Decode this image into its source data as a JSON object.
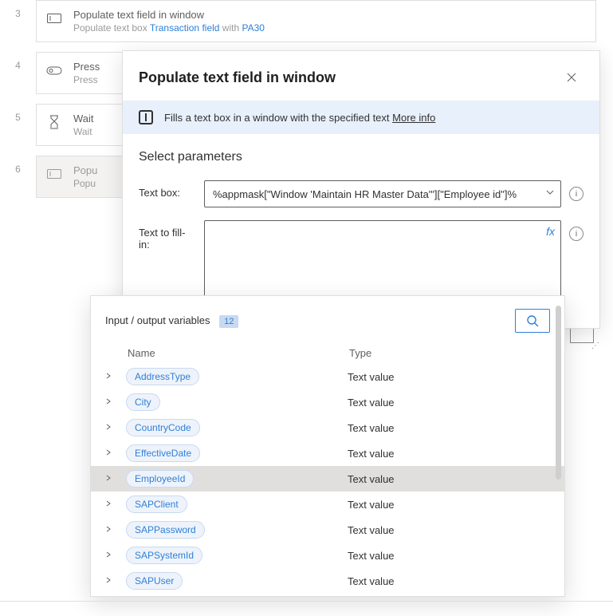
{
  "steps": [
    {
      "num": "3",
      "title": "Populate text field in window",
      "sub_pre": "Populate text box ",
      "sub_link": "Transaction field",
      "sub_mid": " with ",
      "sub_link2": "PA30"
    },
    {
      "num": "4",
      "title": "Press",
      "sub": "Press"
    },
    {
      "num": "5",
      "title": "Wait",
      "sub": "Wait"
    },
    {
      "num": "6",
      "title": "Popu",
      "sub": "Popu",
      "selected": true
    }
  ],
  "dialog": {
    "title": "Populate text field in window",
    "info_text": "Fills a text box in a window with the specified text ",
    "info_link": "More info",
    "section_title": "Select parameters",
    "param_textbox_label": "Text box:",
    "param_textbox_value": "%appmask[\"Window 'Maintain HR Master Data'\"][\"Employee id\"]%",
    "param_fill_label": "Text to fill-in:",
    "param_fill_value": ""
  },
  "vars": {
    "header": "Input / output variables",
    "count": "12",
    "col_name": "Name",
    "col_type": "Type",
    "items": [
      {
        "name": "AddressType",
        "type": "Text value"
      },
      {
        "name": "City",
        "type": "Text value"
      },
      {
        "name": "CountryCode",
        "type": "Text value"
      },
      {
        "name": "EffectiveDate",
        "type": "Text value"
      },
      {
        "name": "EmployeeId",
        "type": "Text value",
        "highlight": true
      },
      {
        "name": "SAPClient",
        "type": "Text value"
      },
      {
        "name": "SAPPassword",
        "type": "Text value"
      },
      {
        "name": "SAPSystemId",
        "type": "Text value"
      },
      {
        "name": "SAPUser",
        "type": "Text value"
      }
    ]
  }
}
